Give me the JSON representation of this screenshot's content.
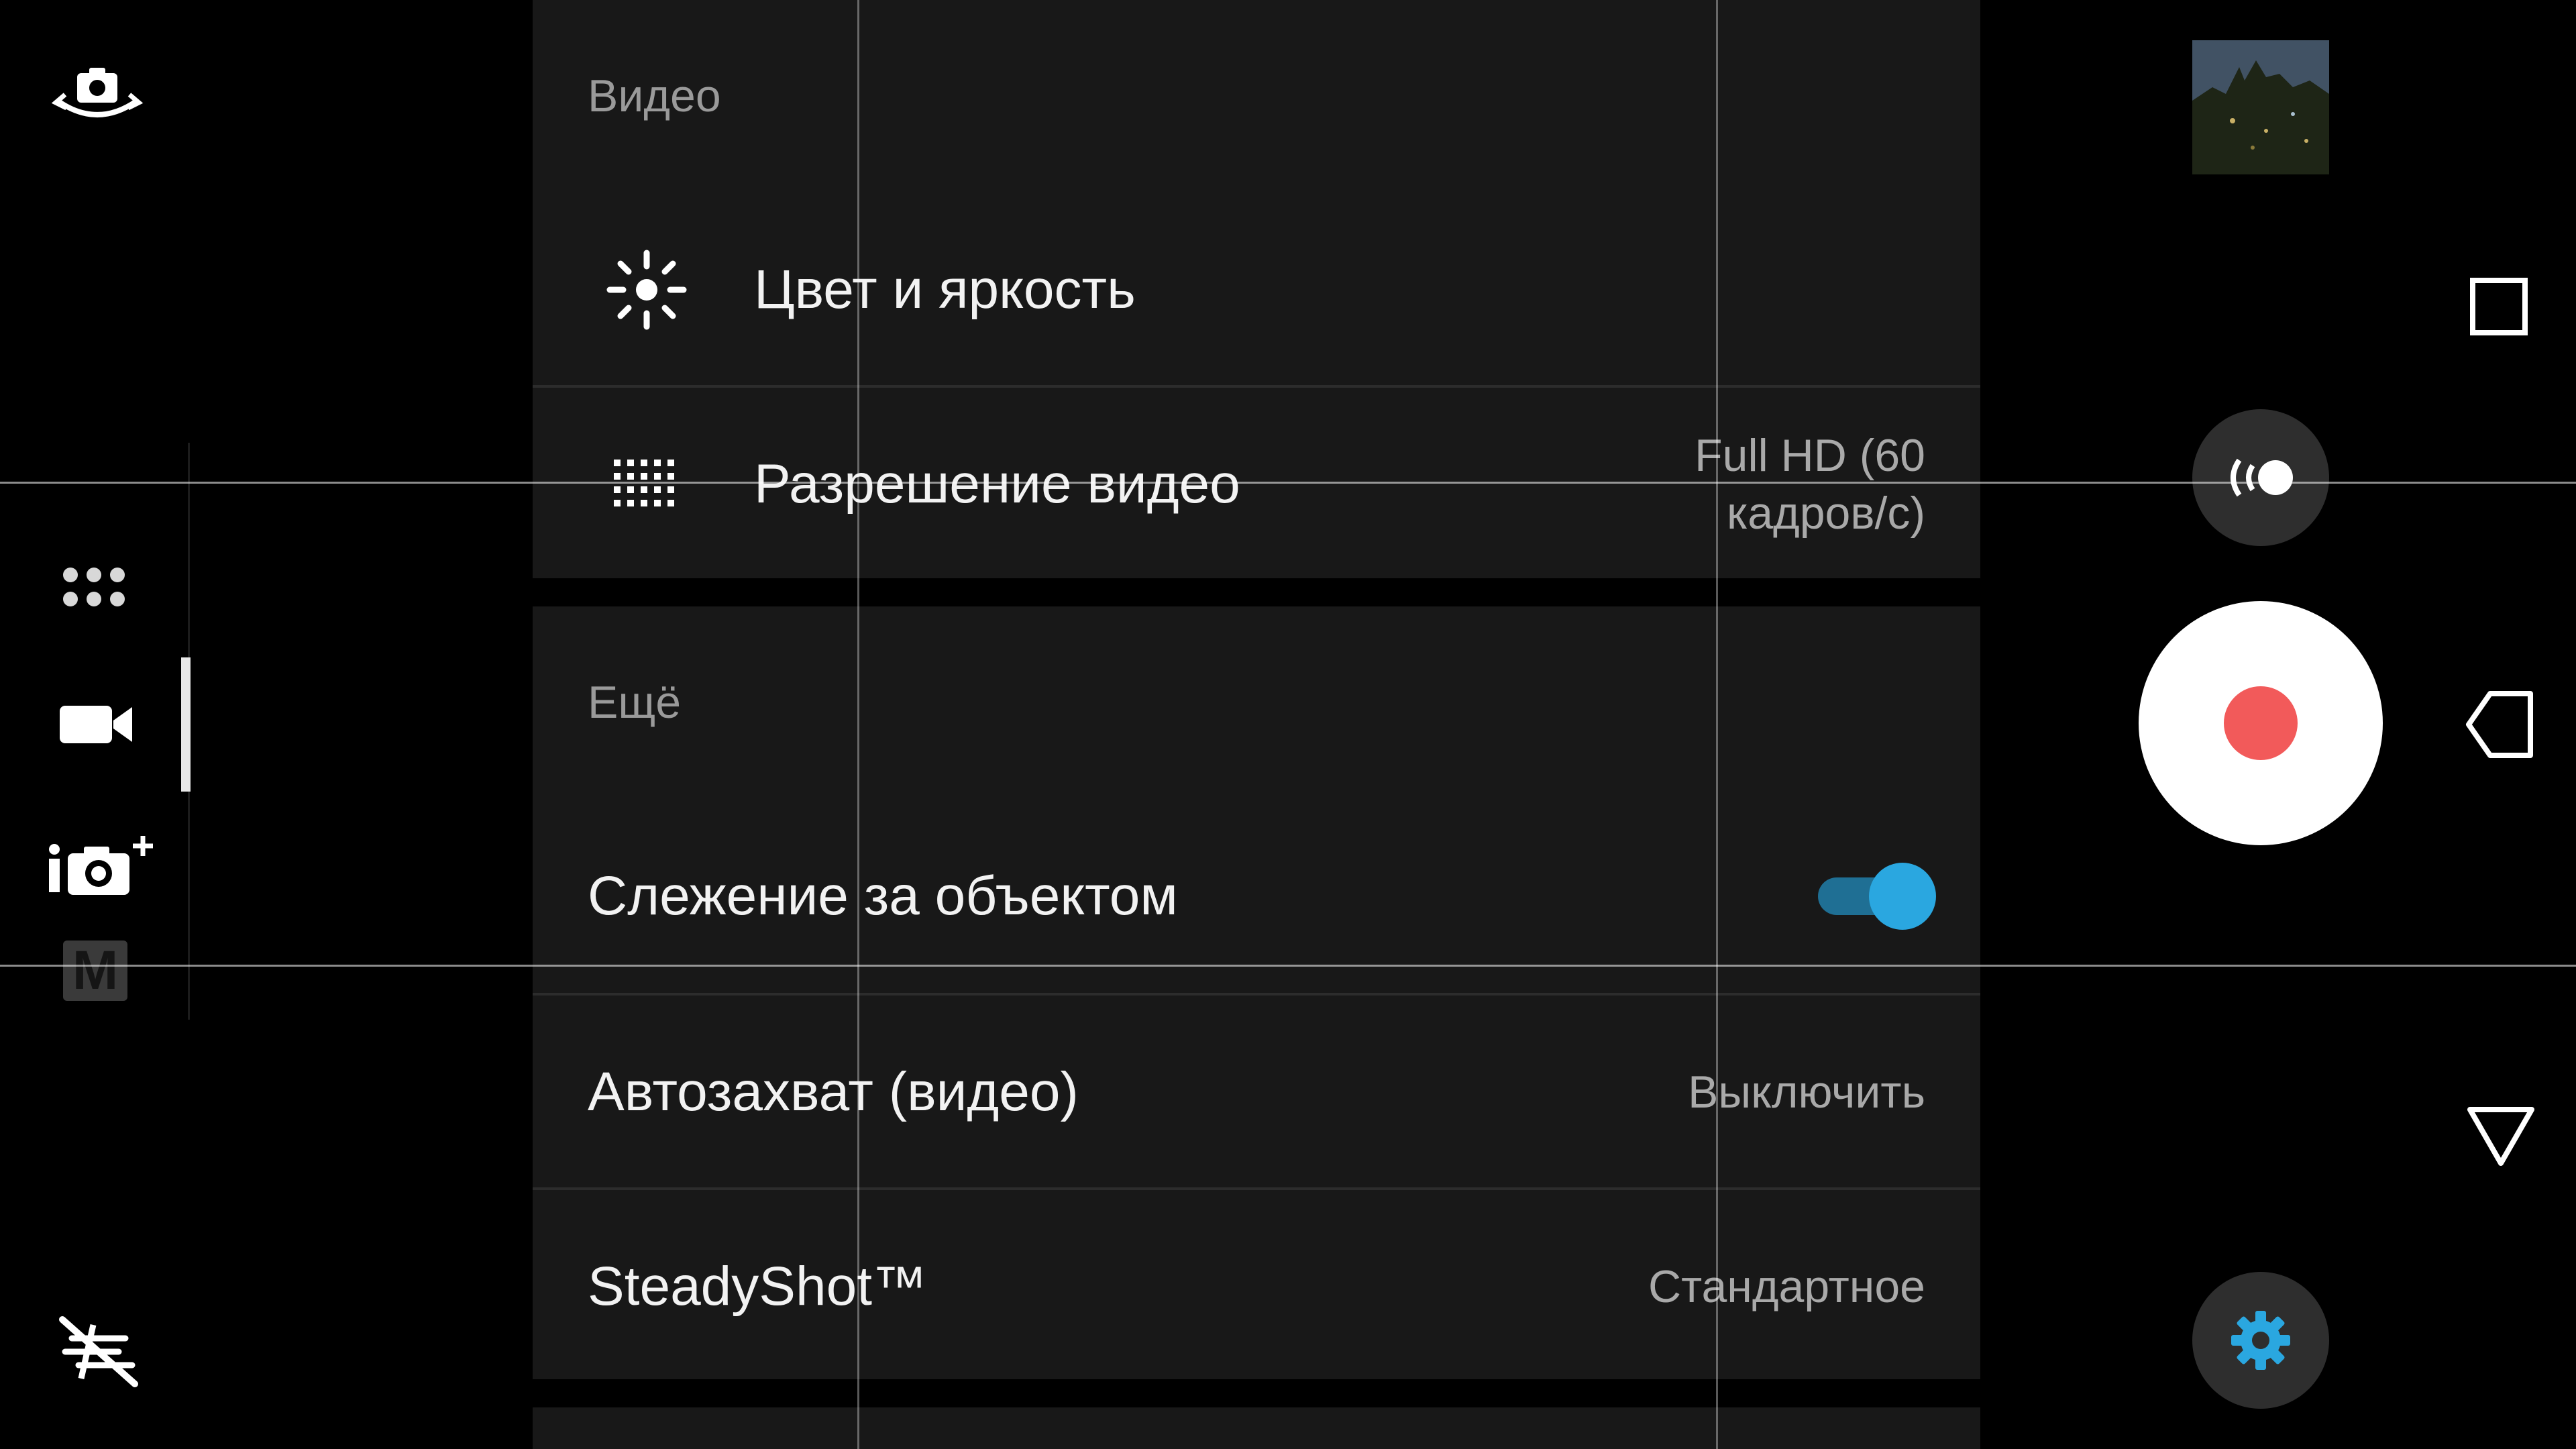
{
  "left_rail": {
    "icons": [
      "switch-camera-icon",
      "apps-grid-icon",
      "video-mode-icon",
      "add-photo-mode-icon",
      "manual-mode-icon",
      "flash-off-icon"
    ],
    "manual_mode_letter": "M"
  },
  "panel": {
    "video_section": {
      "title": "Видео",
      "rows": [
        {
          "label": "Цвет и яркость",
          "icon": "brightness-icon"
        },
        {
          "label": "Разрешение видео",
          "icon": "resolution-grid-icon",
          "value_line1": "Full HD (60",
          "value_line2": "кадров/с)"
        }
      ]
    },
    "more_section": {
      "title": "Ещё",
      "rows": [
        {
          "label": "Слежение за объектом",
          "toggle_on": true
        },
        {
          "label": "Автозахват (видео)",
          "value": "Выключить"
        },
        {
          "label": "SteadyShot™",
          "value": "Стандартное"
        }
      ]
    }
  },
  "right_rail": {
    "icons": [
      "gallery-thumbnail",
      "live-stream-icon",
      "record-button",
      "settings-gear-icon"
    ]
  },
  "nav_bar": {
    "icons": [
      "recents-icon",
      "back-icon",
      "hide-keyboard-icon"
    ]
  },
  "colors": {
    "record_dot": "#f25a5a",
    "toggle_accent": "#2aa7e0",
    "gear_accent": "#2aa7e0",
    "panel_bg": "#181818"
  }
}
